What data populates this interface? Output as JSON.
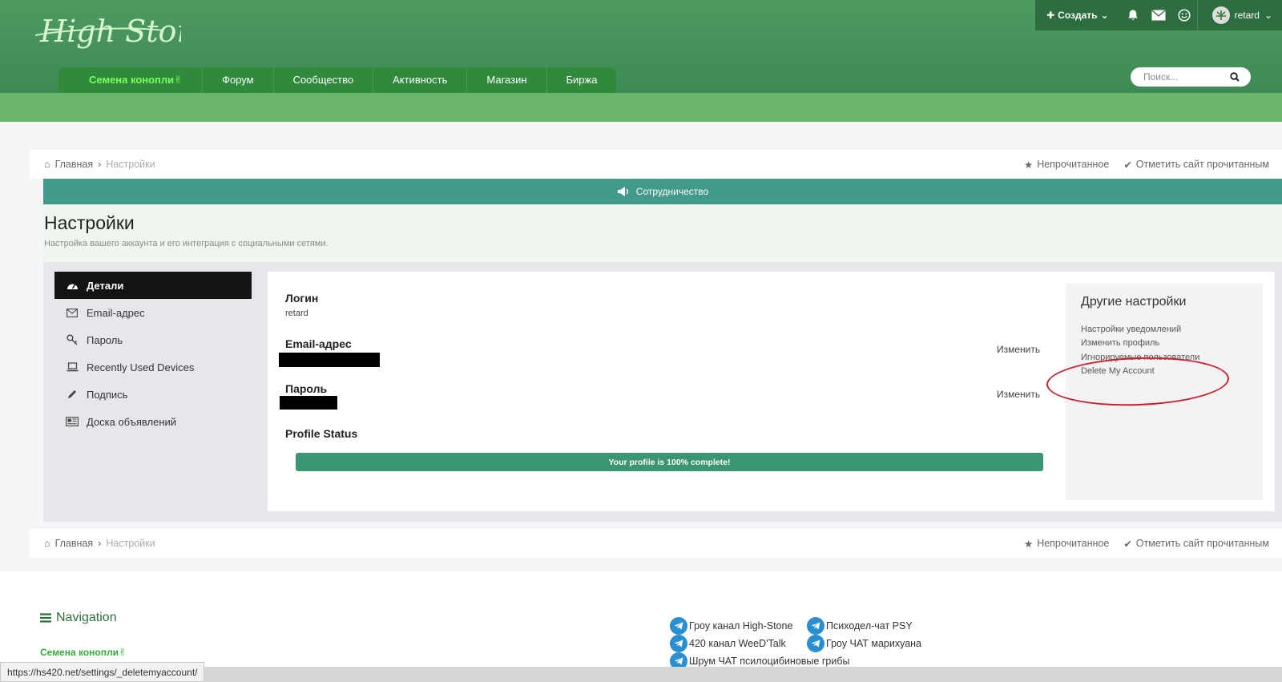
{
  "brand": {
    "logo_text": "High Stone"
  },
  "topbar": {
    "create_label": "Создать",
    "username": "retard"
  },
  "nav": {
    "items": [
      {
        "label": "Семена конопли✌"
      },
      {
        "label": "Форум"
      },
      {
        "label": "Сообщество"
      },
      {
        "label": "Активность"
      },
      {
        "label": "Магазин"
      },
      {
        "label": "Биржа"
      }
    ]
  },
  "search": {
    "placeholder": "Поиск..."
  },
  "breadcrumb": {
    "home": "Главная",
    "current": "Настройки",
    "unread": "Непрочитанное",
    "mark_read": "Отметить сайт прочитанным"
  },
  "banner": {
    "text": "Сотрудничество"
  },
  "page": {
    "title": "Настройки",
    "description": "Настройка вашего аккаунта и его интеграция с социальными сетями."
  },
  "sidebar": {
    "items": [
      {
        "label": "Детали",
        "icon": "dashboard-icon"
      },
      {
        "label": "Email-адрес",
        "icon": "envelope-icon"
      },
      {
        "label": "Пароль",
        "icon": "key-icon"
      },
      {
        "label": "Recently Used Devices",
        "icon": "laptop-icon"
      },
      {
        "label": "Подпись",
        "icon": "pencil-icon"
      },
      {
        "label": "Доска объявлений",
        "icon": "newspaper-icon"
      }
    ]
  },
  "details": {
    "login_label": "Логин",
    "login_value": "retard",
    "email_label": "Email-адрес",
    "email_change": "Изменить",
    "password_label": "Пароль",
    "password_change": "Изменить",
    "profile_status_label": "Profile Status",
    "progress_text": "Your profile is 100% complete!",
    "progress_percent": 100
  },
  "other_settings": {
    "title": "Другие настройки",
    "links": [
      "Настройки уведомлений",
      "Изменить профиль",
      "Игнорируемые пользователи",
      "Delete My Account"
    ]
  },
  "footer": {
    "nav_title": "Navigation",
    "nav_link": "Семена конопли✌",
    "telegram_links": [
      "Гроу канал High-Stone",
      "Психодел-чат PSY",
      "420 канал WeeD'Talk",
      "Гроу ЧАТ марихуана",
      "Шрум ЧАТ псилоцибиновые грибы"
    ]
  },
  "status_url": "https://hs420.net/settings/_deletemyaccount/",
  "colors": {
    "header_green": "#4f9a61",
    "nav_green": "#2f8a3c",
    "active_nav": "#7cff5b",
    "banner": "#449a8a",
    "progress": "#3a9570",
    "annotation": "#c8212a"
  }
}
